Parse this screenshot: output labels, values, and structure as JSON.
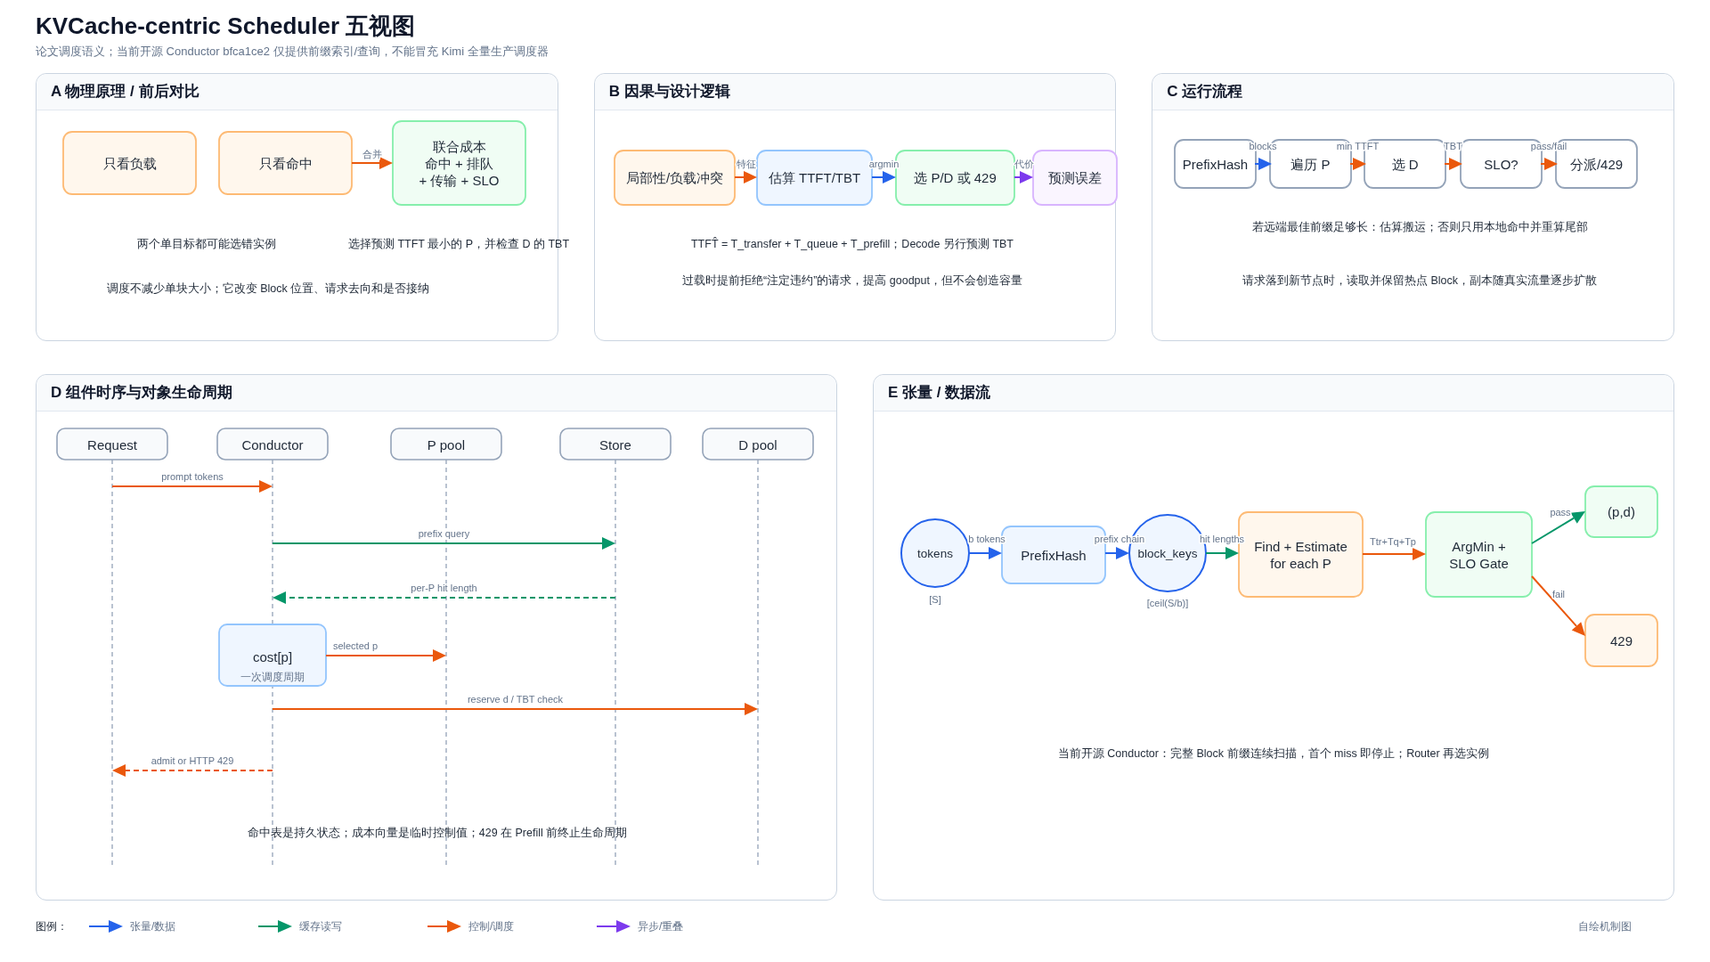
{
  "title": "KVCache-centric Scheduler 五视图",
  "subtitle": "论文调度语义；当前开源 Conductor bfca1ce2 仅提供前缀索引/查询，不能冒充 Kimi 全量生产调度器",
  "panel_a": {
    "title": "A 物理原理 / 前后对比",
    "nodes": [
      {
        "lines": [
          "只看负载"
        ],
        "color": "#fdba74"
      },
      {
        "lines": [
          "只看命中"
        ],
        "color": "#fdba74"
      },
      {
        "lines": [
          "联合成本",
          "命中 + 排队",
          "+ 传输 + SLO"
        ],
        "color": "#86efac"
      }
    ],
    "edges": [
      {
        "label": "合并",
        "color": "#ea580c"
      }
    ],
    "notes": [
      "两个单目标都可能选错实例",
      "选择预测 TTFT 最小的 P，并检查 D 的 TBT",
      "调度不减少单块大小；它改变 Block 位置、请求去向和是否接纳"
    ]
  },
  "panel_b": {
    "title": "B 因果与设计逻辑",
    "nodes": [
      {
        "lines": [
          "局部性/负载冲突"
        ],
        "color": "#fdba74"
      },
      {
        "lines": [
          "估算 TTFT/TBT"
        ],
        "color": "#93c5fd"
      },
      {
        "lines": [
          "选 P/D 或 429"
        ],
        "color": "#86efac"
      },
      {
        "lines": [
          "预测误差"
        ],
        "color": "#d8b4fe"
      }
    ],
    "edges": [
      {
        "label": "特征",
        "color": "#ea580c"
      },
      {
        "label": "argmin",
        "color": "#2563eb"
      },
      {
        "label": "代价",
        "color": "#7c3aed"
      }
    ],
    "notes": [
      "TTFT̂ = T_transfer + T_queue + T_prefill；Decode 另行预测 TBT",
      "过载时提前拒绝“注定违约”的请求，提高 goodput，但不会创造容量"
    ]
  },
  "panel_c": {
    "title": "C 运行流程",
    "nodes": [
      {
        "lines": [
          "PrefixHash"
        ],
        "color": "#94a3b8"
      },
      {
        "lines": [
          "遍历 P"
        ],
        "color": "#94a3b8"
      },
      {
        "lines": [
          "选 D"
        ],
        "color": "#94a3b8"
      },
      {
        "lines": [
          "SLO?"
        ],
        "color": "#94a3b8"
      },
      {
        "lines": [
          "分派/429"
        ],
        "color": "#94a3b8"
      }
    ],
    "edges": [
      {
        "label": "blocks",
        "color": "#2563eb"
      },
      {
        "label": "min TTFT",
        "color": "#ea580c"
      },
      {
        "label": "TBT",
        "color": "#ea580c"
      },
      {
        "label": "pass/fail",
        "color": "#ea580c"
      }
    ],
    "notes": [
      "若远端最佳前缀足够长：估算搬运；否则只用本地命中并重算尾部",
      "请求落到新节点时，读取并保留热点 Block，副本随真实流量逐步扩散"
    ]
  },
  "panel_d": {
    "title": "D 组件时序与对象生命周期",
    "lifelines": [
      "Request",
      "Conductor",
      "P pool",
      "Store",
      "D pool"
    ],
    "messages": [
      {
        "label": "prompt tokens",
        "color": "#ea580c",
        "kind": "call"
      },
      {
        "label": "prefix query",
        "color": "#059669",
        "kind": "call"
      },
      {
        "label": "per-P hit length",
        "color": "#059669",
        "kind": "reply"
      },
      {
        "label": "selected p",
        "color": "#ea580c",
        "kind": "call"
      },
      {
        "label": "reserve d / TBT check",
        "color": "#ea580c",
        "kind": "call"
      },
      {
        "label": "admit or HTTP 429",
        "color": "#ea580c",
        "kind": "reply"
      }
    ],
    "activation": {
      "label": "cost[p]",
      "caption": "一次调度周期"
    },
    "notes": [
      "命中表是持久状态；成本向量是临时控制值；429 在 Prefill 前终止生命周期"
    ]
  },
  "panel_e": {
    "title": "E 张量 / 数据流",
    "nodes": [
      {
        "kind": "tensor",
        "lines": [
          "tokens"
        ],
        "shape_label": "[S]"
      },
      {
        "kind": "op",
        "lines": [
          "PrefixHash"
        ],
        "color": "#93c5fd"
      },
      {
        "kind": "tensor",
        "lines": [
          "block_keys"
        ],
        "shape_label": "[ceil(S/b)]"
      },
      {
        "kind": "op",
        "lines": [
          "Find + Estimate",
          "for each P"
        ],
        "color": "#fdba74"
      },
      {
        "kind": "op",
        "lines": [
          "ArgMin +",
          "SLO Gate"
        ],
        "color": "#86efac"
      },
      {
        "kind": "op",
        "lines": [
          "(p,d)"
        ],
        "color": "#86efac"
      },
      {
        "kind": "op",
        "lines": [
          "429"
        ],
        "color": "#fdba74"
      }
    ],
    "edges": [
      {
        "label": "b tokens",
        "color": "#2563eb"
      },
      {
        "label": "prefix chain",
        "color": "#2563eb"
      },
      {
        "label": "hit lengths",
        "color": "#059669"
      },
      {
        "label": "Ttr+Tq+Tp",
        "color": "#ea580c"
      },
      {
        "label": "pass",
        "color": "#059669"
      },
      {
        "label": "fail",
        "color": "#ea580c"
      }
    ],
    "notes": [
      "当前开源 Conductor：完整 Block 前缀连续扫描，首个 miss 即停止；Router 再选实例"
    ]
  },
  "legend": {
    "heading": "图例：",
    "items": [
      {
        "label": "张量/数据",
        "color": "#2563eb"
      },
      {
        "label": "缓存读写",
        "color": "#059669"
      },
      {
        "label": "控制/调度",
        "color": "#ea580c"
      },
      {
        "label": "异步/重叠",
        "color": "#7c3aed"
      }
    ],
    "credit": "自绘机制图"
  }
}
